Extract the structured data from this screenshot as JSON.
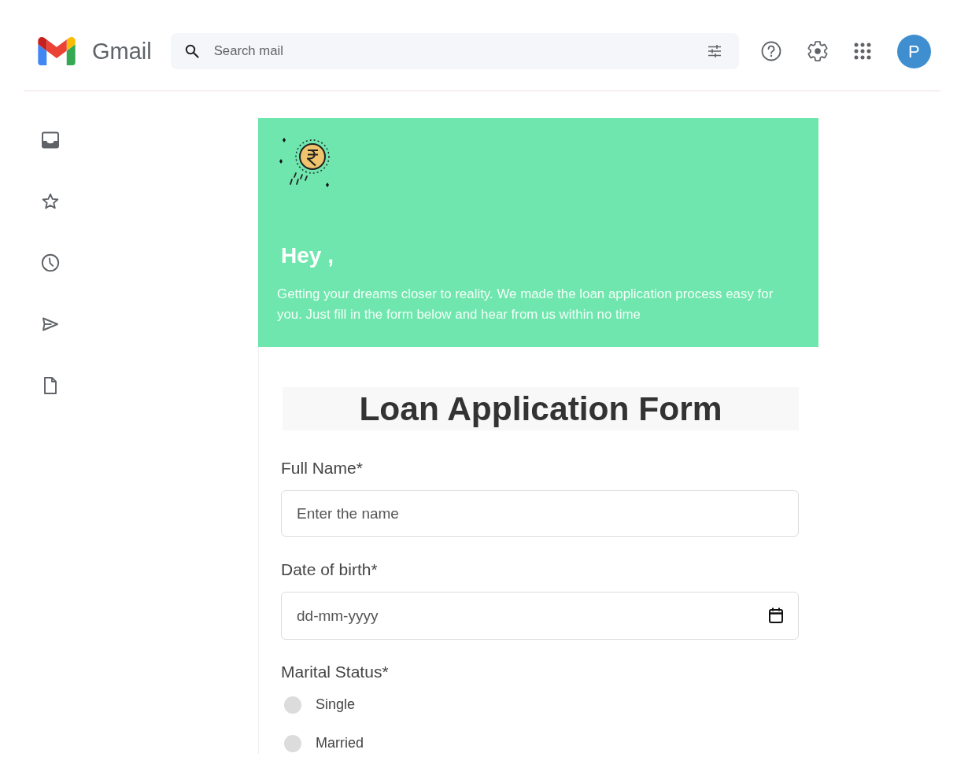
{
  "header": {
    "app_name": "Gmail",
    "search": {
      "placeholder": "Search mail"
    },
    "avatar": {
      "letter": "P"
    }
  },
  "email": {
    "banner": {
      "greeting": "Hey ,",
      "message": "Getting your dreams closer to reality. We made the loan application process easy for you. Just fill in the form below and hear from us within no time"
    },
    "form": {
      "title": "Loan Application Form",
      "fields": [
        {
          "kind": "text",
          "label": "Full Name*",
          "placeholder": "Enter the name"
        },
        {
          "kind": "date",
          "label": "Date of birth*",
          "placeholder": "dd-mm-yyyy"
        },
        {
          "kind": "radio",
          "label": "Marital Status*",
          "options": [
            {
              "label": "Single",
              "selected": false
            },
            {
              "label": "Married",
              "selected": false
            }
          ]
        }
      ]
    }
  }
}
